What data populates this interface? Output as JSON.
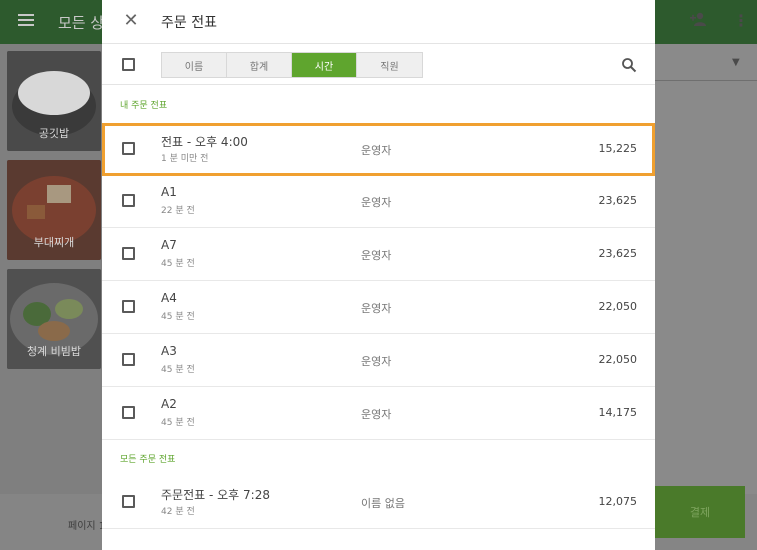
{
  "background": {
    "title": "모든 상",
    "tiles": [
      "공깃밥",
      "부대찌개",
      "청계 비빔밥"
    ],
    "page_label": "페이지 1",
    "pay_label": "결제"
  },
  "dialog": {
    "title": "주문 전표",
    "segments": [
      {
        "label": "이름",
        "active": false
      },
      {
        "label": "합계",
        "active": false
      },
      {
        "label": "시간",
        "active": true
      },
      {
        "label": "직원",
        "active": false
      }
    ],
    "my_section": "내 주문 전표",
    "all_section": "모든 주문 전표",
    "my_tickets": [
      {
        "name": "전표 - 오후 4:00",
        "time": "1 분 미만 전",
        "staff": "운영자",
        "amount": "15,225"
      },
      {
        "name": "A1",
        "time": "22 분 전",
        "staff": "운영자",
        "amount": "23,625"
      },
      {
        "name": "A7",
        "time": "45 분 전",
        "staff": "운영자",
        "amount": "23,625"
      },
      {
        "name": "A4",
        "time": "45 분 전",
        "staff": "운영자",
        "amount": "22,050"
      },
      {
        "name": "A3",
        "time": "45 분 전",
        "staff": "운영자",
        "amount": "22,050"
      },
      {
        "name": "A2",
        "time": "45 분 전",
        "staff": "운영자",
        "amount": "14,175"
      }
    ],
    "all_tickets": [
      {
        "name": "주문전표 - 오후 7:28",
        "time": "42 분 전",
        "staff": "이름 없음",
        "amount": "12,075"
      }
    ]
  },
  "colors": {
    "accent": "#5fa52e",
    "highlight": "#f0a030"
  }
}
